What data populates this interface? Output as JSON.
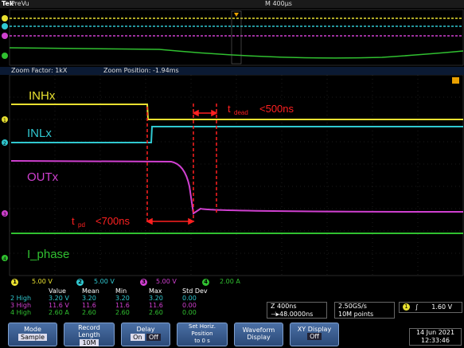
{
  "topbar": {
    "brand": "Tek",
    "mode": "PreVu",
    "timebase": "M 400µs"
  },
  "zoom": {
    "factor": "Zoom Factor: 1kX",
    "position": "Zoom Position: -1.94ms"
  },
  "channel_markers": [
    "1",
    "2",
    "3",
    "4"
  ],
  "waveform_labels": {
    "inh": "INHx",
    "inl": "INLx",
    "out": "OUTx",
    "iphase": "I_phase",
    "tdead": "t",
    "tdead_sub": "dead",
    "tdead_val": "<500ns",
    "tpd": "t",
    "tpd_sub": "pd",
    "tpd_val": "<700ns"
  },
  "colors": {
    "ch1": "#e8e030",
    "ch2": "#30c8d0",
    "ch3": "#d040d0",
    "ch4": "#30c030",
    "annot": "#ff2020"
  },
  "channels": [
    {
      "num": "1",
      "scale": "5.00 V"
    },
    {
      "num": "2",
      "scale": "5.00 V"
    },
    {
      "num": "3",
      "scale": "5.00 V"
    },
    {
      "num": "4",
      "scale": "2.00 A"
    }
  ],
  "measurements": {
    "headers": [
      "",
      "Value",
      "Mean",
      "Min",
      "Max",
      "Std Dev"
    ],
    "rows": [
      {
        "ch": "2",
        "label": "High",
        "value": "3.20 V",
        "mean": "3.20",
        "min": "3.20",
        "max": "3.20",
        "std": "0.00"
      },
      {
        "ch": "3",
        "label": "High",
        "value": "11.6 V",
        "mean": "11.6",
        "min": "11.6",
        "max": "11.6",
        "std": "0.00"
      },
      {
        "ch": "4",
        "label": "High",
        "value": "2.60 A",
        "mean": "2.60",
        "min": "2.60",
        "max": "2.60",
        "std": "0.00"
      }
    ]
  },
  "horizontal": {
    "zoom_scale": "Z 400ns",
    "position": "⊣▸48.0000ns"
  },
  "sampling": {
    "rate": "2.50GS/s",
    "points": "10M points"
  },
  "trigger": {
    "ch": "1",
    "slope": "∫",
    "level": "1.60 V"
  },
  "menu": [
    {
      "top": "Mode",
      "sub": "Sample"
    },
    {
      "top": "Record\nLength",
      "sub": "10M"
    },
    {
      "top": "Delay",
      "on": "On",
      "off": "Off"
    },
    {
      "top": "Set Horiz.\nPosition\nto 0 s",
      "sub": ""
    },
    {
      "top": "Waveform\nDisplay",
      "sub": ""
    },
    {
      "top": "XY Display",
      "sub": "Off"
    }
  ],
  "datetime": {
    "date": "14 Jun 2021",
    "time": "12:33:46"
  }
}
